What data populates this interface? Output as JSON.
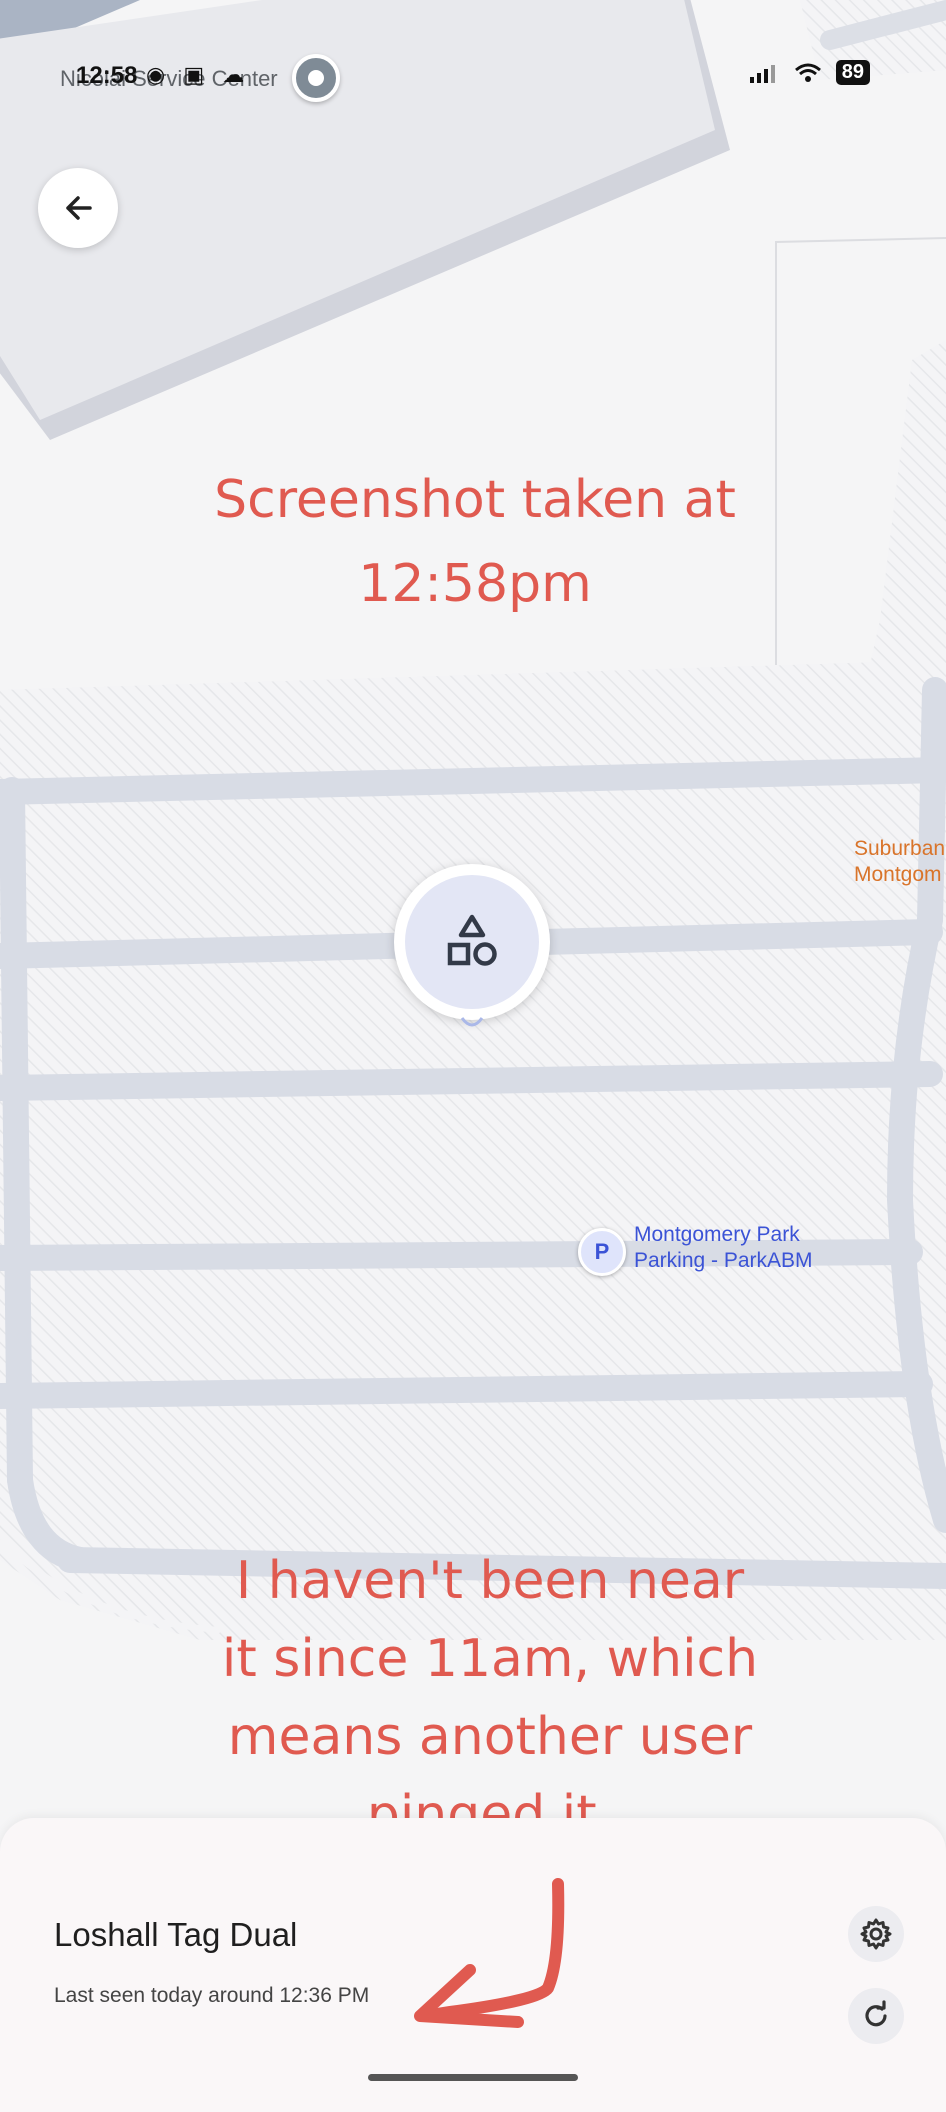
{
  "status_bar": {
    "time": "12:58",
    "place_text": "Nicolai Service Center",
    "left_icons": [
      "eye-icon",
      "linkedin-icon",
      "cloud-icon"
    ],
    "battery": "89"
  },
  "map": {
    "labels": {
      "suburban": [
        "Suburban",
        "Montgom"
      ],
      "parking_letter": "P",
      "parking": [
        "Montgomery Park",
        "Parking - ParkABM"
      ]
    }
  },
  "annotations": {
    "top": [
      "Screenshot taken at",
      "12:58pm"
    ],
    "bottom": [
      "I haven't been near",
      "it since 11am, which",
      "means another user",
      "pinged it."
    ],
    "color": "#e05a50"
  },
  "device_sheet": {
    "device_name": "Loshall Tag Dual",
    "last_seen": "Last seen today around 12:36 PM"
  }
}
